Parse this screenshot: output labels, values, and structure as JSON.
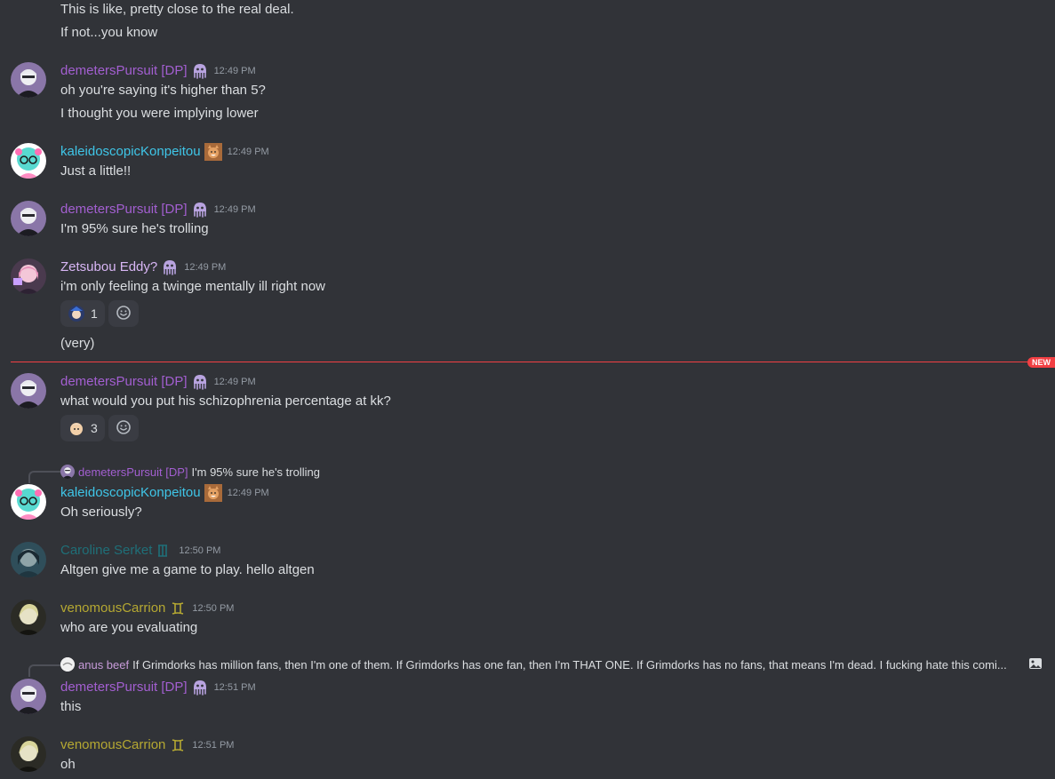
{
  "colors": {
    "dp": "#a35fd1",
    "kk": "#3fc6e8",
    "zed": "#d8b6f5",
    "caroline": "#1f6f78",
    "venom": "#b5a832",
    "anus": "#c79bd9",
    "new": "#f23f43"
  },
  "messages": {
    "m0": {
      "l1": "This is like, pretty close to the real deal.",
      "l2": "If not...you know"
    },
    "m1": {
      "name": "demetersPursuit [DP]",
      "time": "12:49 PM",
      "l1": "oh you're saying it's higher than 5?",
      "l2": "I thought you were implying lower"
    },
    "m2": {
      "name": "kaleidoscopicKonpeitou",
      "time": "12:49 PM",
      "l1": "Just a little!!"
    },
    "m3": {
      "name": "demetersPursuit [DP]",
      "time": "12:49 PM",
      "l1": "I'm 95% sure he's trolling"
    },
    "m4": {
      "name": "Zetsubou Eddy?",
      "time": "12:49 PM",
      "l1": "i'm only feeling a twinge mentally ill right now",
      "react_count": "1",
      "l2": "(very)"
    },
    "m5": {
      "name": "demetersPursuit [DP]",
      "time": "12:49 PM",
      "l1": "what would you put his schizophrenia percentage at kk?",
      "react_count": "3"
    },
    "m6": {
      "reply_name": "demetersPursuit [DP]",
      "reply_text": "I'm 95% sure he's trolling",
      "name": "kaleidoscopicKonpeitou",
      "time": "12:49 PM",
      "l1": "Oh seriously?"
    },
    "m7": {
      "name": "Caroline Serket",
      "time": "12:50 PM",
      "l1": "Altgen give me  a game to play. hello altgen"
    },
    "m8": {
      "name": "venomousCarrion",
      "time": "12:50 PM",
      "l1": "who are you evaluating"
    },
    "m9": {
      "reply_name": "anus beef",
      "reply_text": "If Grimdorks has million fans, then I'm one of them. If Grimdorks has one fan, then I'm THAT ONE. If Grimdorks has no fans, that means I'm dead.  I fucking hate this comi...",
      "name": "demetersPursuit [DP]",
      "time": "12:51 PM",
      "l1": "this"
    },
    "m10": {
      "name": "venomousCarrion",
      "time": "12:51 PM",
      "l1": "oh"
    }
  },
  "new_label": "NEW",
  "icons": {
    "dp_badge": "squid-icon",
    "kk_badge": "shiba-icon",
    "caroline_badge": "aquarius-sign-icon",
    "venom_badge": "gemini-sign-icon",
    "add_reaction": "smiley-add-icon",
    "reply_image": "image-icon"
  }
}
